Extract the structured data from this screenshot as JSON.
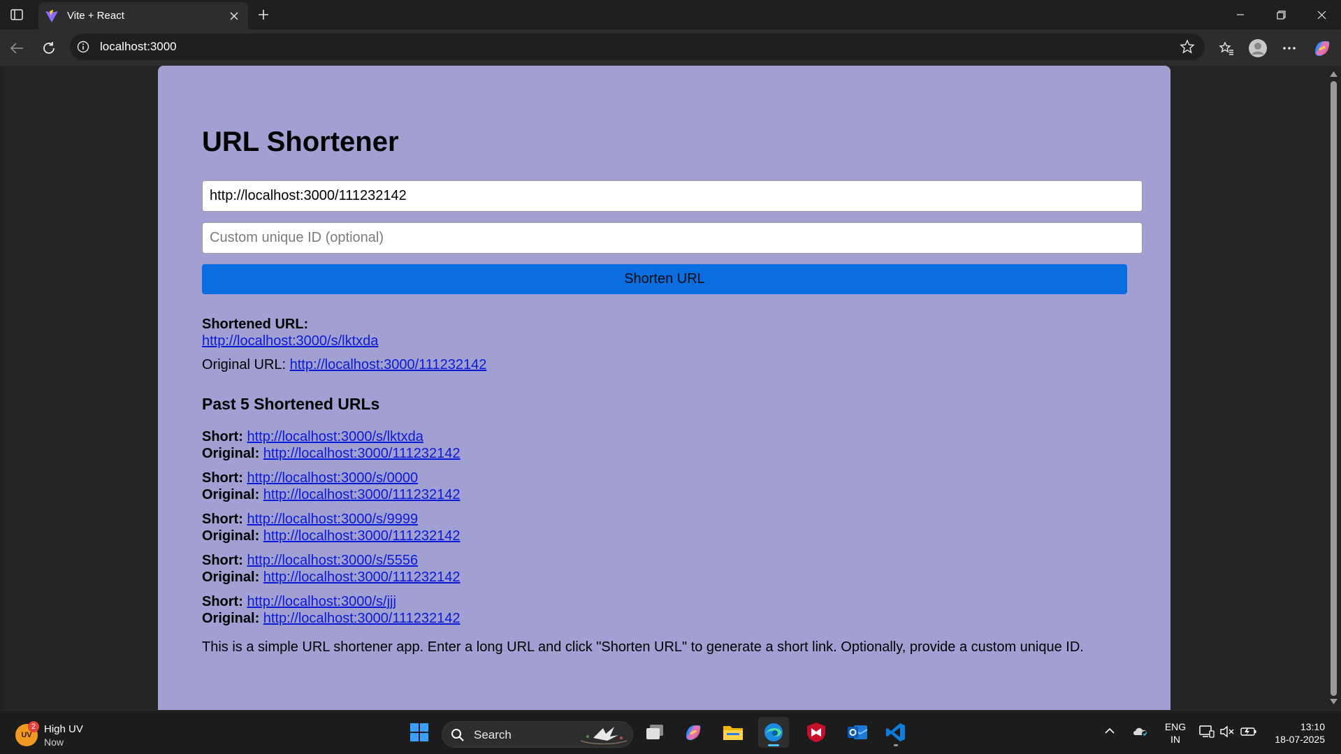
{
  "browser": {
    "tab_title": "Vite + React",
    "address": "localhost:3000"
  },
  "app": {
    "title": "URL Shortener",
    "url_input_value": "http://localhost:3000/111232142",
    "custom_id_placeholder": "Custom unique ID (optional)",
    "shorten_button": "Shorten URL",
    "result": {
      "label": "Shortened URL:",
      "short_url": "http://localhost:3000/s/lktxda",
      "original_label": "Original URL:",
      "original_url": "http://localhost:3000/111232142"
    },
    "history_title": "Past 5 Shortened URLs",
    "short_label": "Short:",
    "original_label": "Original:",
    "history": [
      {
        "short": "http://localhost:3000/s/lktxda",
        "original": "http://localhost:3000/111232142"
      },
      {
        "short": "http://localhost:3000/s/0000",
        "original": "http://localhost:3000/111232142"
      },
      {
        "short": "http://localhost:3000/s/9999",
        "original": "http://localhost:3000/111232142"
      },
      {
        "short": "http://localhost:3000/s/5556",
        "original": "http://localhost:3000/111232142"
      },
      {
        "short": "http://localhost:3000/s/jjj",
        "original": "http://localhost:3000/111232142"
      }
    ],
    "description": "This is a simple URL shortener app. Enter a long URL and click \"Shorten URL\" to generate a short link. Optionally, provide a custom unique ID."
  },
  "taskbar": {
    "weather_badge": "2",
    "weather_icon_text": "UV",
    "weather_title": "High UV",
    "weather_subtitle": "Now",
    "search_label": "Search",
    "language_top": "ENG",
    "language_bottom": "IN",
    "time": "13:10",
    "date": "18-07-2025"
  },
  "colors": {
    "app_background": "#a2a0d2",
    "button": "#0a6de0",
    "link": "#0a1bd6",
    "browser_chrome": "#1f1f1f",
    "taskbar": "#1c1c1c"
  },
  "icons": [
    "sidebar-icon",
    "vite-logo-icon",
    "close-icon",
    "plus-icon",
    "minimize-icon",
    "restore-icon",
    "window-close-icon",
    "back-icon",
    "refresh-icon",
    "info-icon",
    "star-icon",
    "favorites-icon",
    "profile-icon",
    "more-icon",
    "copilot-icon",
    "windows-start-icon",
    "search-icon",
    "task-view-icon",
    "copilot-app-icon",
    "file-explorer-icon",
    "edge-icon",
    "mcafee-icon",
    "outlook-icon",
    "vscode-icon",
    "chevron-up-icon",
    "onedrive-icon",
    "display-icon",
    "mute-icon",
    "battery-icon"
  ]
}
